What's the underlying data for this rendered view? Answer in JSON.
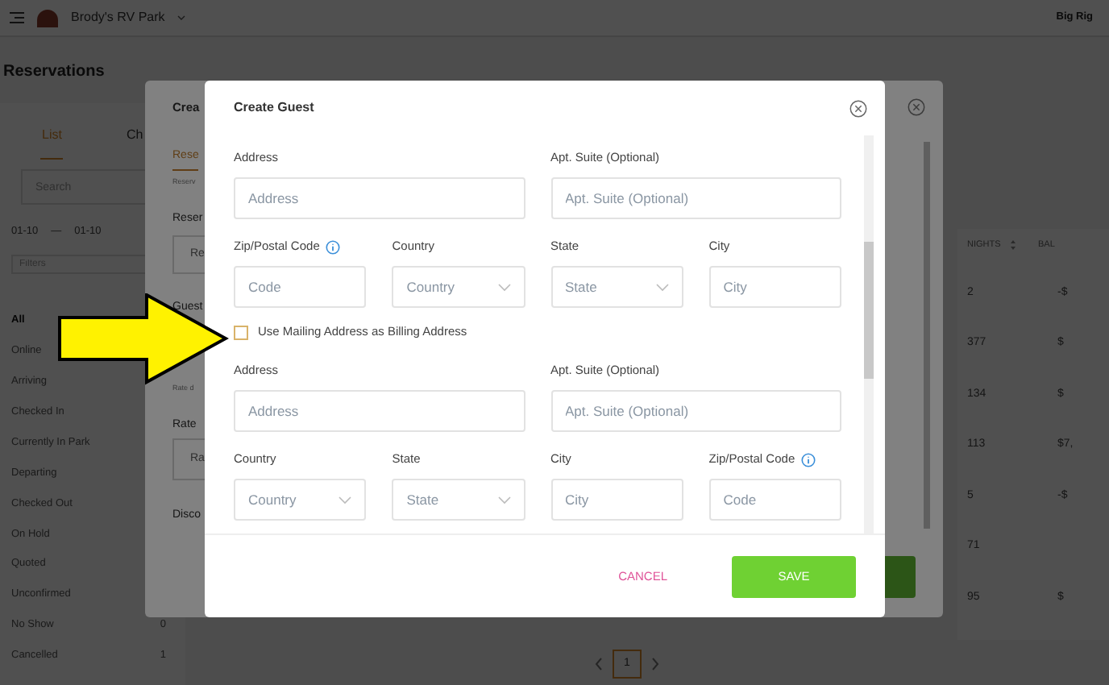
{
  "header": {
    "park_name": "Brody's RV Park",
    "right_text": "Big Rig"
  },
  "page_title": "Reservations",
  "tabs": [
    {
      "label": "List",
      "selected": true
    },
    {
      "label": "Ch",
      "selected": false
    }
  ],
  "search": {
    "placeholder": "Search"
  },
  "date_range": {
    "from": "01-10",
    "separator": "—",
    "to": "01-10"
  },
  "filters": {
    "placeholder": "Filters"
  },
  "statuses": [
    {
      "label": "All",
      "selected": true
    },
    {
      "label": "Online",
      "selected": false
    },
    {
      "label": "Arriving",
      "selected": false
    },
    {
      "label": "Checked In",
      "selected": false
    },
    {
      "label": "Currently In Park",
      "selected": false
    },
    {
      "label": "Departing",
      "selected": false
    },
    {
      "label": "Checked Out",
      "selected": false
    },
    {
      "label": "On Hold",
      "selected": false
    },
    {
      "label": "Quoted",
      "selected": false
    },
    {
      "label": "Unconfirmed",
      "selected": false
    },
    {
      "label": "No Show",
      "count": "0",
      "selected": false
    },
    {
      "label": "Cancelled",
      "count": "1",
      "selected": false
    }
  ],
  "table": {
    "columns": [
      "NIGHTS",
      "BAL"
    ],
    "rows": [
      {
        "nights": "2",
        "balance": "-$"
      },
      {
        "nights": "377",
        "balance": "$"
      },
      {
        "nights": "134",
        "balance": "$"
      },
      {
        "nights": "113",
        "balance": "$7,"
      },
      {
        "nights": "5",
        "balance": "-$"
      },
      {
        "nights": "71"
      },
      {
        "nights": "95",
        "balance": "$"
      }
    ]
  },
  "pagination": {
    "page": "1"
  },
  "back_modal": {
    "title": "Crea",
    "tab": "Rese",
    "note": "Reserv",
    "label_1": "Reser",
    "field_1": "Re",
    "label_2": "Guest",
    "note_2": "Rate d",
    "label_3": "Rate",
    "field_3": "Ra",
    "label_4": "Disco"
  },
  "create_guest": {
    "title": "Create Guest",
    "rows": [
      [
        {
          "kind": "input",
          "label": "Address",
          "placeholder": "Address"
        },
        {
          "kind": "input",
          "label": "Apt. Suite (Optional)",
          "placeholder": "Apt. Suite (Optional)"
        }
      ],
      [
        {
          "kind": "input",
          "label": "Zip/Postal Code",
          "placeholder": "Code",
          "info": true
        },
        {
          "kind": "select",
          "label": "Country",
          "placeholder": "Country"
        },
        {
          "kind": "select",
          "label": "State",
          "placeholder": "State"
        },
        {
          "kind": "input",
          "label": "City",
          "placeholder": "City"
        }
      ],
      [
        {
          "kind": "checkbox",
          "label": "Use Mailing Address as Billing Address",
          "checked": false
        }
      ],
      [
        {
          "kind": "input",
          "label": "Address",
          "placeholder": "Address"
        },
        {
          "kind": "input",
          "label": "Apt. Suite (Optional)",
          "placeholder": "Apt. Suite (Optional)"
        }
      ],
      [
        {
          "kind": "select",
          "label": "Country",
          "placeholder": "Country"
        },
        {
          "kind": "select",
          "label": "State",
          "placeholder": "State"
        },
        {
          "kind": "input",
          "label": "City",
          "placeholder": "City"
        },
        {
          "kind": "input",
          "label": "Zip/Postal Code",
          "placeholder": "Code",
          "info": true
        }
      ]
    ],
    "cancel": "CANCEL",
    "save": "SAVE"
  }
}
